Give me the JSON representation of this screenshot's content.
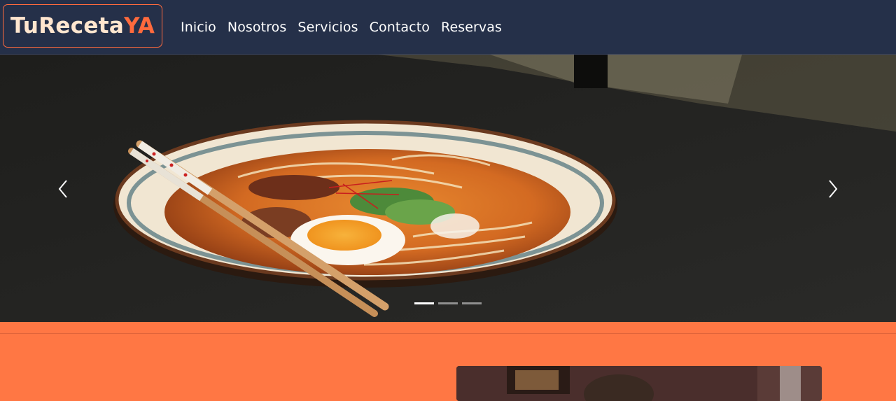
{
  "brand": {
    "part1": "TuReceta",
    "part2": "YA"
  },
  "nav": {
    "items": [
      {
        "label": "Inicio"
      },
      {
        "label": "Nosotros"
      },
      {
        "label": "Servicios"
      },
      {
        "label": "Contacto"
      },
      {
        "label": "Reservas"
      }
    ]
  },
  "carousel": {
    "slide_count": 3,
    "active_index": 0,
    "image": "ramen-bowl-photo"
  },
  "colors": {
    "navbar": "#253049",
    "accent": "#ff7744",
    "brand_accent": "#ff6a3d",
    "brand_light": "#ffe6cf"
  }
}
